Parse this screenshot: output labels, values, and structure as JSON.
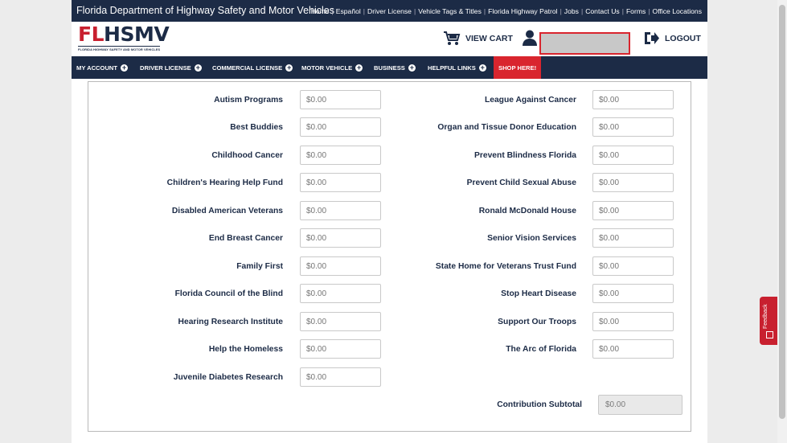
{
  "topbar": {
    "agency": "Florida Department of Highway Safety and Motor Vehicles",
    "links": [
      "Home",
      "Español",
      "Driver License",
      "Vehicle Tags & Titles",
      "Florida Highway Patrol",
      "Jobs",
      "Contact Us",
      "Forms",
      "Office Locations"
    ]
  },
  "logo": {
    "fl": "FL",
    "hsmv": "HSMV",
    "tagline": "FLORIDA HIGHWAY SAFETY AND MOTOR VEHICLES"
  },
  "header": {
    "cart_label": "VIEW CART",
    "logout_label": "LOGOUT",
    "user_field_value": ""
  },
  "nav": {
    "items": [
      "MY ACCOUNT",
      "DRIVER LICENSE",
      "COMMERCIAL LICENSE",
      "MOTOR VEHICLE",
      "BUSINESS",
      "HELPFUL LINKS"
    ],
    "shop": "SHOP HERE!"
  },
  "placeholder": "$0.00",
  "left_column": [
    "Autism Programs",
    "Best Buddies",
    "Childhood Cancer",
    "Children's Hearing Help Fund",
    "Disabled American Veterans",
    "End Breast Cancer",
    "Family First",
    "Florida Council of the Blind",
    "Hearing Research Institute",
    "Help the Homeless",
    "Juvenile Diabetes Research"
  ],
  "right_column": [
    "League Against Cancer",
    "Organ and Tissue Donor Education",
    "Prevent Blindness Florida",
    "Prevent Child Sexual Abuse",
    "Ronald McDonald House",
    "Senior Vision Services",
    "State Home for Veterans Trust Fund",
    "Stop Heart Disease",
    "Support Our Troops",
    "The Arc of Florida"
  ],
  "subtotal": {
    "label": "Contribution Subtotal",
    "value": "$0.00"
  },
  "feedback": "Feedback",
  "colors": {
    "navy": "#1c2b46",
    "red": "#d9252e"
  }
}
